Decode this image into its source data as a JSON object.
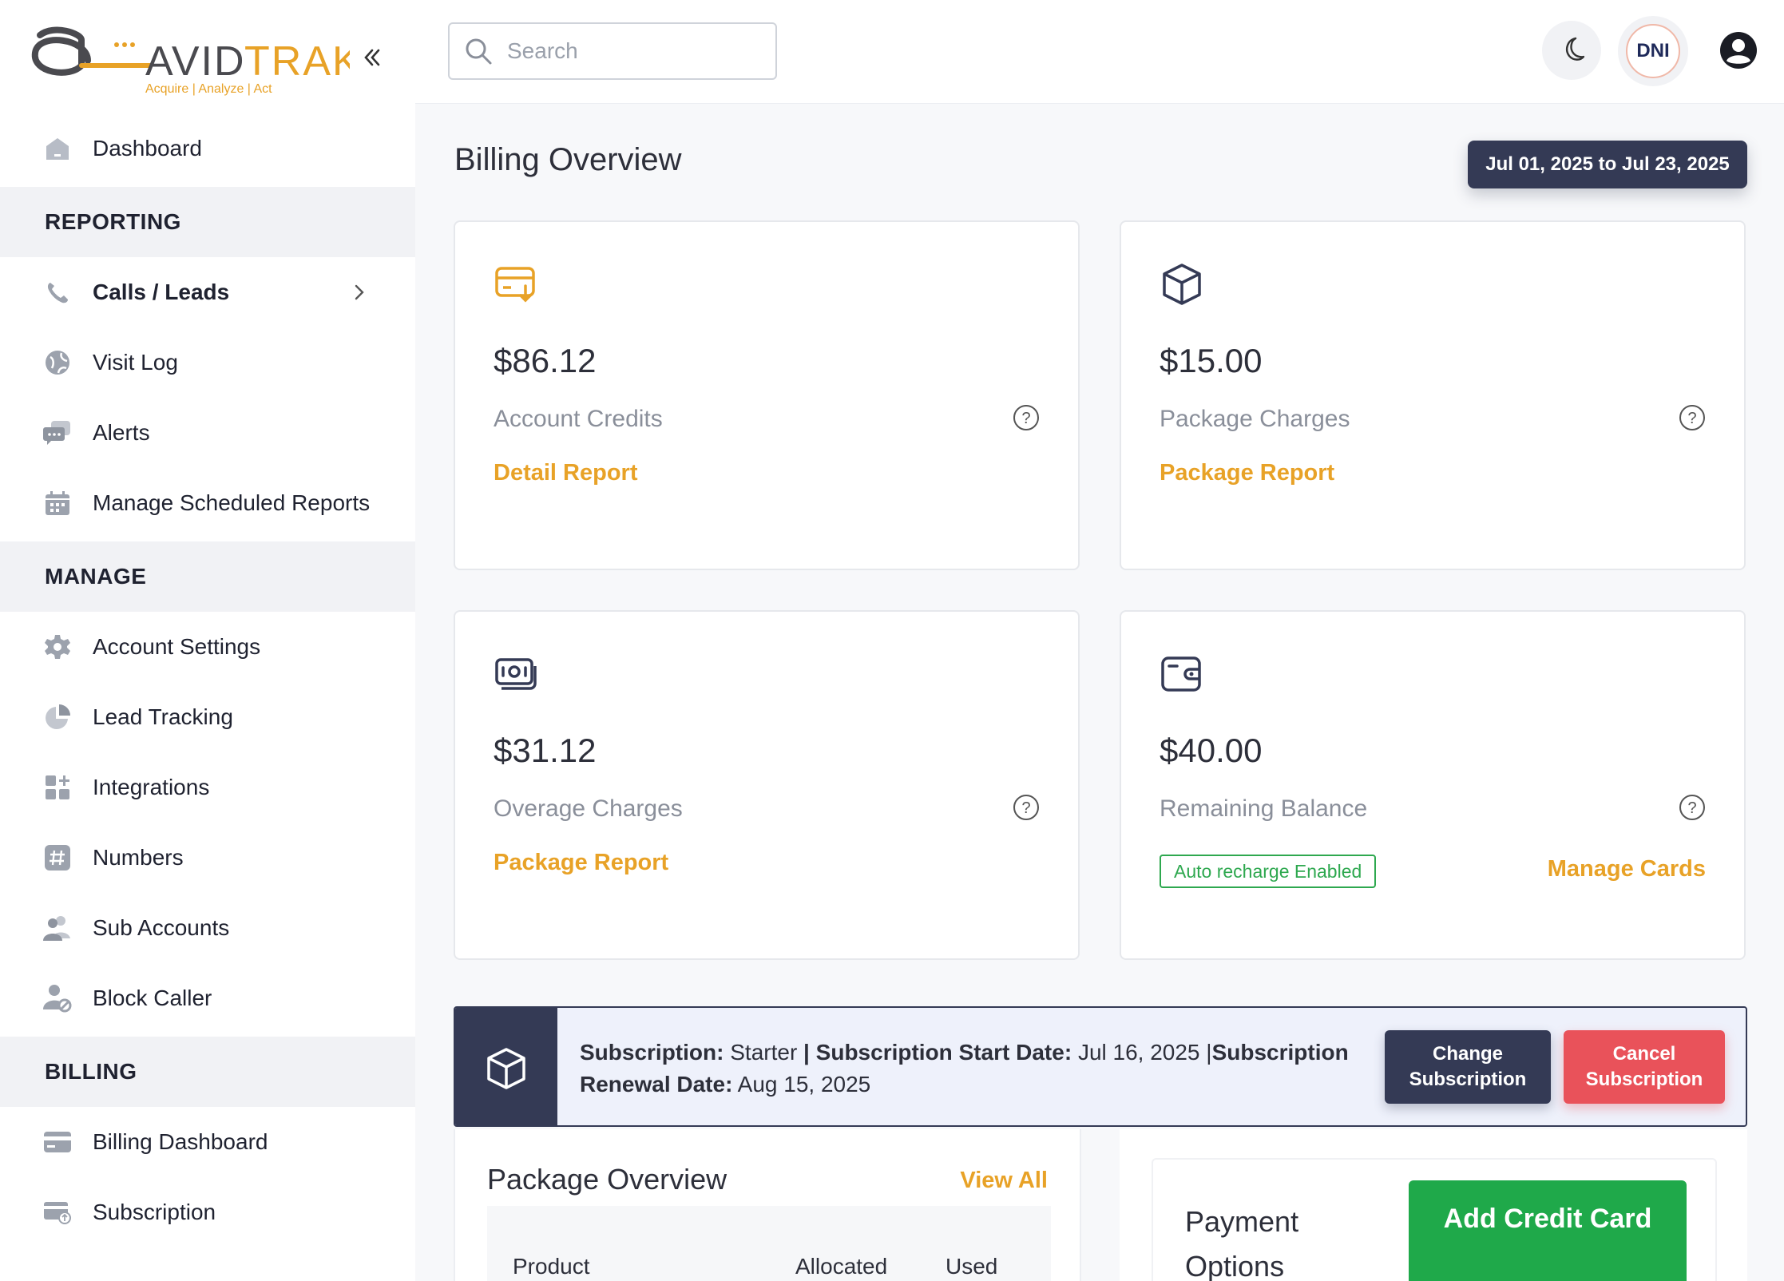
{
  "brand": {
    "name": "AVIDTRAK",
    "tagline": [
      "Acquire",
      "Analyze",
      "Act"
    ],
    "accent": "#e8a227",
    "dark": "#343a55"
  },
  "sidebar": {
    "dashboard": "Dashboard",
    "sections": {
      "reporting": "REPORTING",
      "manage": "MANAGE",
      "billing": "BILLING"
    },
    "reporting_items": [
      "Calls / Leads",
      "Visit Log",
      "Alerts",
      "Manage Scheduled Reports"
    ],
    "manage_items": [
      "Account Settings",
      "Lead Tracking",
      "Integrations",
      "Numbers",
      "Sub Accounts",
      "Block Caller"
    ],
    "billing_items": [
      "Billing Dashboard",
      "Subscription"
    ]
  },
  "header": {
    "search_placeholder": "Search",
    "dni_label": "DNI"
  },
  "page": {
    "title": "Billing Overview",
    "date_range": "Jul 01, 2025 to Jul 23, 2025"
  },
  "cards": {
    "credits": {
      "amount": "$86.12",
      "label": "Account Credits",
      "link": "Detail Report"
    },
    "package": {
      "amount": "$15.00",
      "label": "Package Charges",
      "link": "Package Report"
    },
    "overage": {
      "amount": "$31.12",
      "label": "Overage Charges",
      "link": "Package Report"
    },
    "balance": {
      "amount": "$40.00",
      "label": "Remaining Balance",
      "badge": "Auto recharge Enabled",
      "link": "Manage Cards"
    }
  },
  "subscription": {
    "plan_label": "Subscription:",
    "plan_value": "Starter",
    "start_label": "| Subscription Start Date:",
    "start_value": "Jul 16, 2025 |",
    "renewal_label_a": "Subscription",
    "renewal_label_b": "Renewal Date:",
    "renewal_value": "Aug 15, 2025",
    "change_button": "Change Subscription",
    "cancel_button": "Cancel Subscription"
  },
  "package_overview": {
    "title": "Package Overview",
    "view_all": "View All",
    "columns": [
      "Product",
      "Allocated",
      "Used"
    ]
  },
  "payment": {
    "title": "Payment Options",
    "add_card": "Add Credit Card"
  }
}
